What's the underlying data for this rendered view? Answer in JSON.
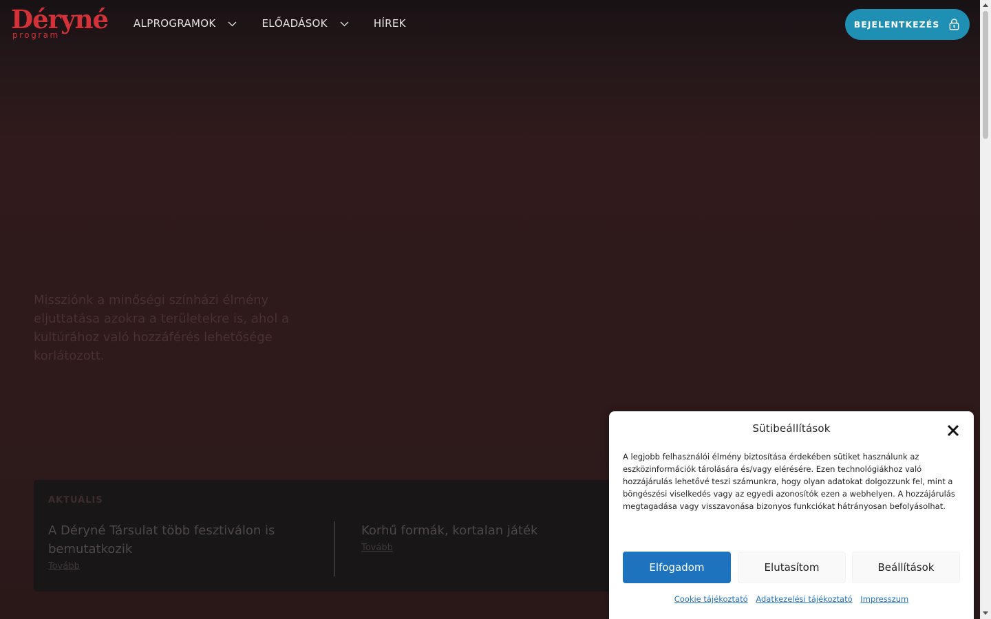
{
  "logo": {
    "main": "Déryné",
    "sub": "program"
  },
  "nav": {
    "items": [
      {
        "label": "ALPROGRAMOK",
        "has_dropdown": true
      },
      {
        "label": "ELŐADÁSOK",
        "has_dropdown": true
      },
      {
        "label": "HÍREK",
        "has_dropdown": false
      }
    ]
  },
  "login": {
    "label": "BEJELENTKEZÉS",
    "icon": "lock-icon"
  },
  "mission": {
    "text": "Missziónk a minőségi színházi élmény eljuttatása azokra a területekre is, ahol a kultúrához való hozzáférés lehetősége korlátozott."
  },
  "news": {
    "label": "AKTUÁLIS",
    "items": [
      {
        "title": "A Déryné Társulat több fesztiválon is bemutatkozik",
        "more": "Tovább"
      },
      {
        "title": "Korhű formák, kortalan játék",
        "more": "Tovább"
      }
    ]
  },
  "cookie": {
    "title": "Sütibeállítások",
    "text": "A legjobb felhasználói élmény biztosítása érdekében sütiket használunk az eszközinformációk tárolására és/vagy elérésére. Ezen technológiákhoz való hozzájárulás lehetővé teszi számunkra, hogy olyan adatokat dolgozzunk fel, mint a böngészési viselkedés vagy az egyedi azonosítók ezen a webhelyen. A hozzájárulás megtagadása vagy visszavonása bizonyos funkciókat hátrányosan befolyásolhat.",
    "buttons": {
      "accept": "Elfogadom",
      "deny": "Elutasítom",
      "settings": "Beállítások"
    },
    "links": [
      "Cookie tájékoztató",
      "Adatkezelési tájékoztató",
      "Impresszum"
    ]
  },
  "colors": {
    "brand_red": "#d23238",
    "login_blue": "#1f8fb4",
    "accept_blue": "#1e73be"
  }
}
